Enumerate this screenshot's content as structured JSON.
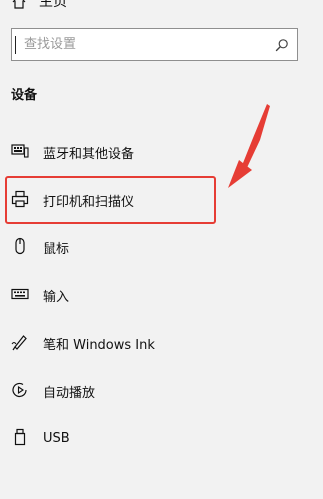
{
  "home": {
    "label": "主页"
  },
  "search": {
    "placeholder": "查找设置",
    "value": ""
  },
  "section": {
    "title": "设备"
  },
  "nav": {
    "items": [
      {
        "id": "bluetooth",
        "label": "蓝牙和其他设备",
        "icon": "bluetooth-devices-icon"
      },
      {
        "id": "printers",
        "label": "打印机和扫描仪",
        "icon": "printer-icon",
        "highlighted": true
      },
      {
        "id": "mouse",
        "label": "鼠标",
        "icon": "mouse-icon"
      },
      {
        "id": "typing",
        "label": "输入",
        "icon": "keyboard-icon"
      },
      {
        "id": "pen",
        "label": "笔和 Windows Ink",
        "icon": "pen-icon"
      },
      {
        "id": "autoplay",
        "label": "自动播放",
        "icon": "autoplay-icon"
      },
      {
        "id": "usb",
        "label": "USB",
        "icon": "usb-icon"
      }
    ]
  },
  "colors": {
    "background": "#f2f2f2",
    "annotation": "#e63d35",
    "text": "#111111"
  }
}
